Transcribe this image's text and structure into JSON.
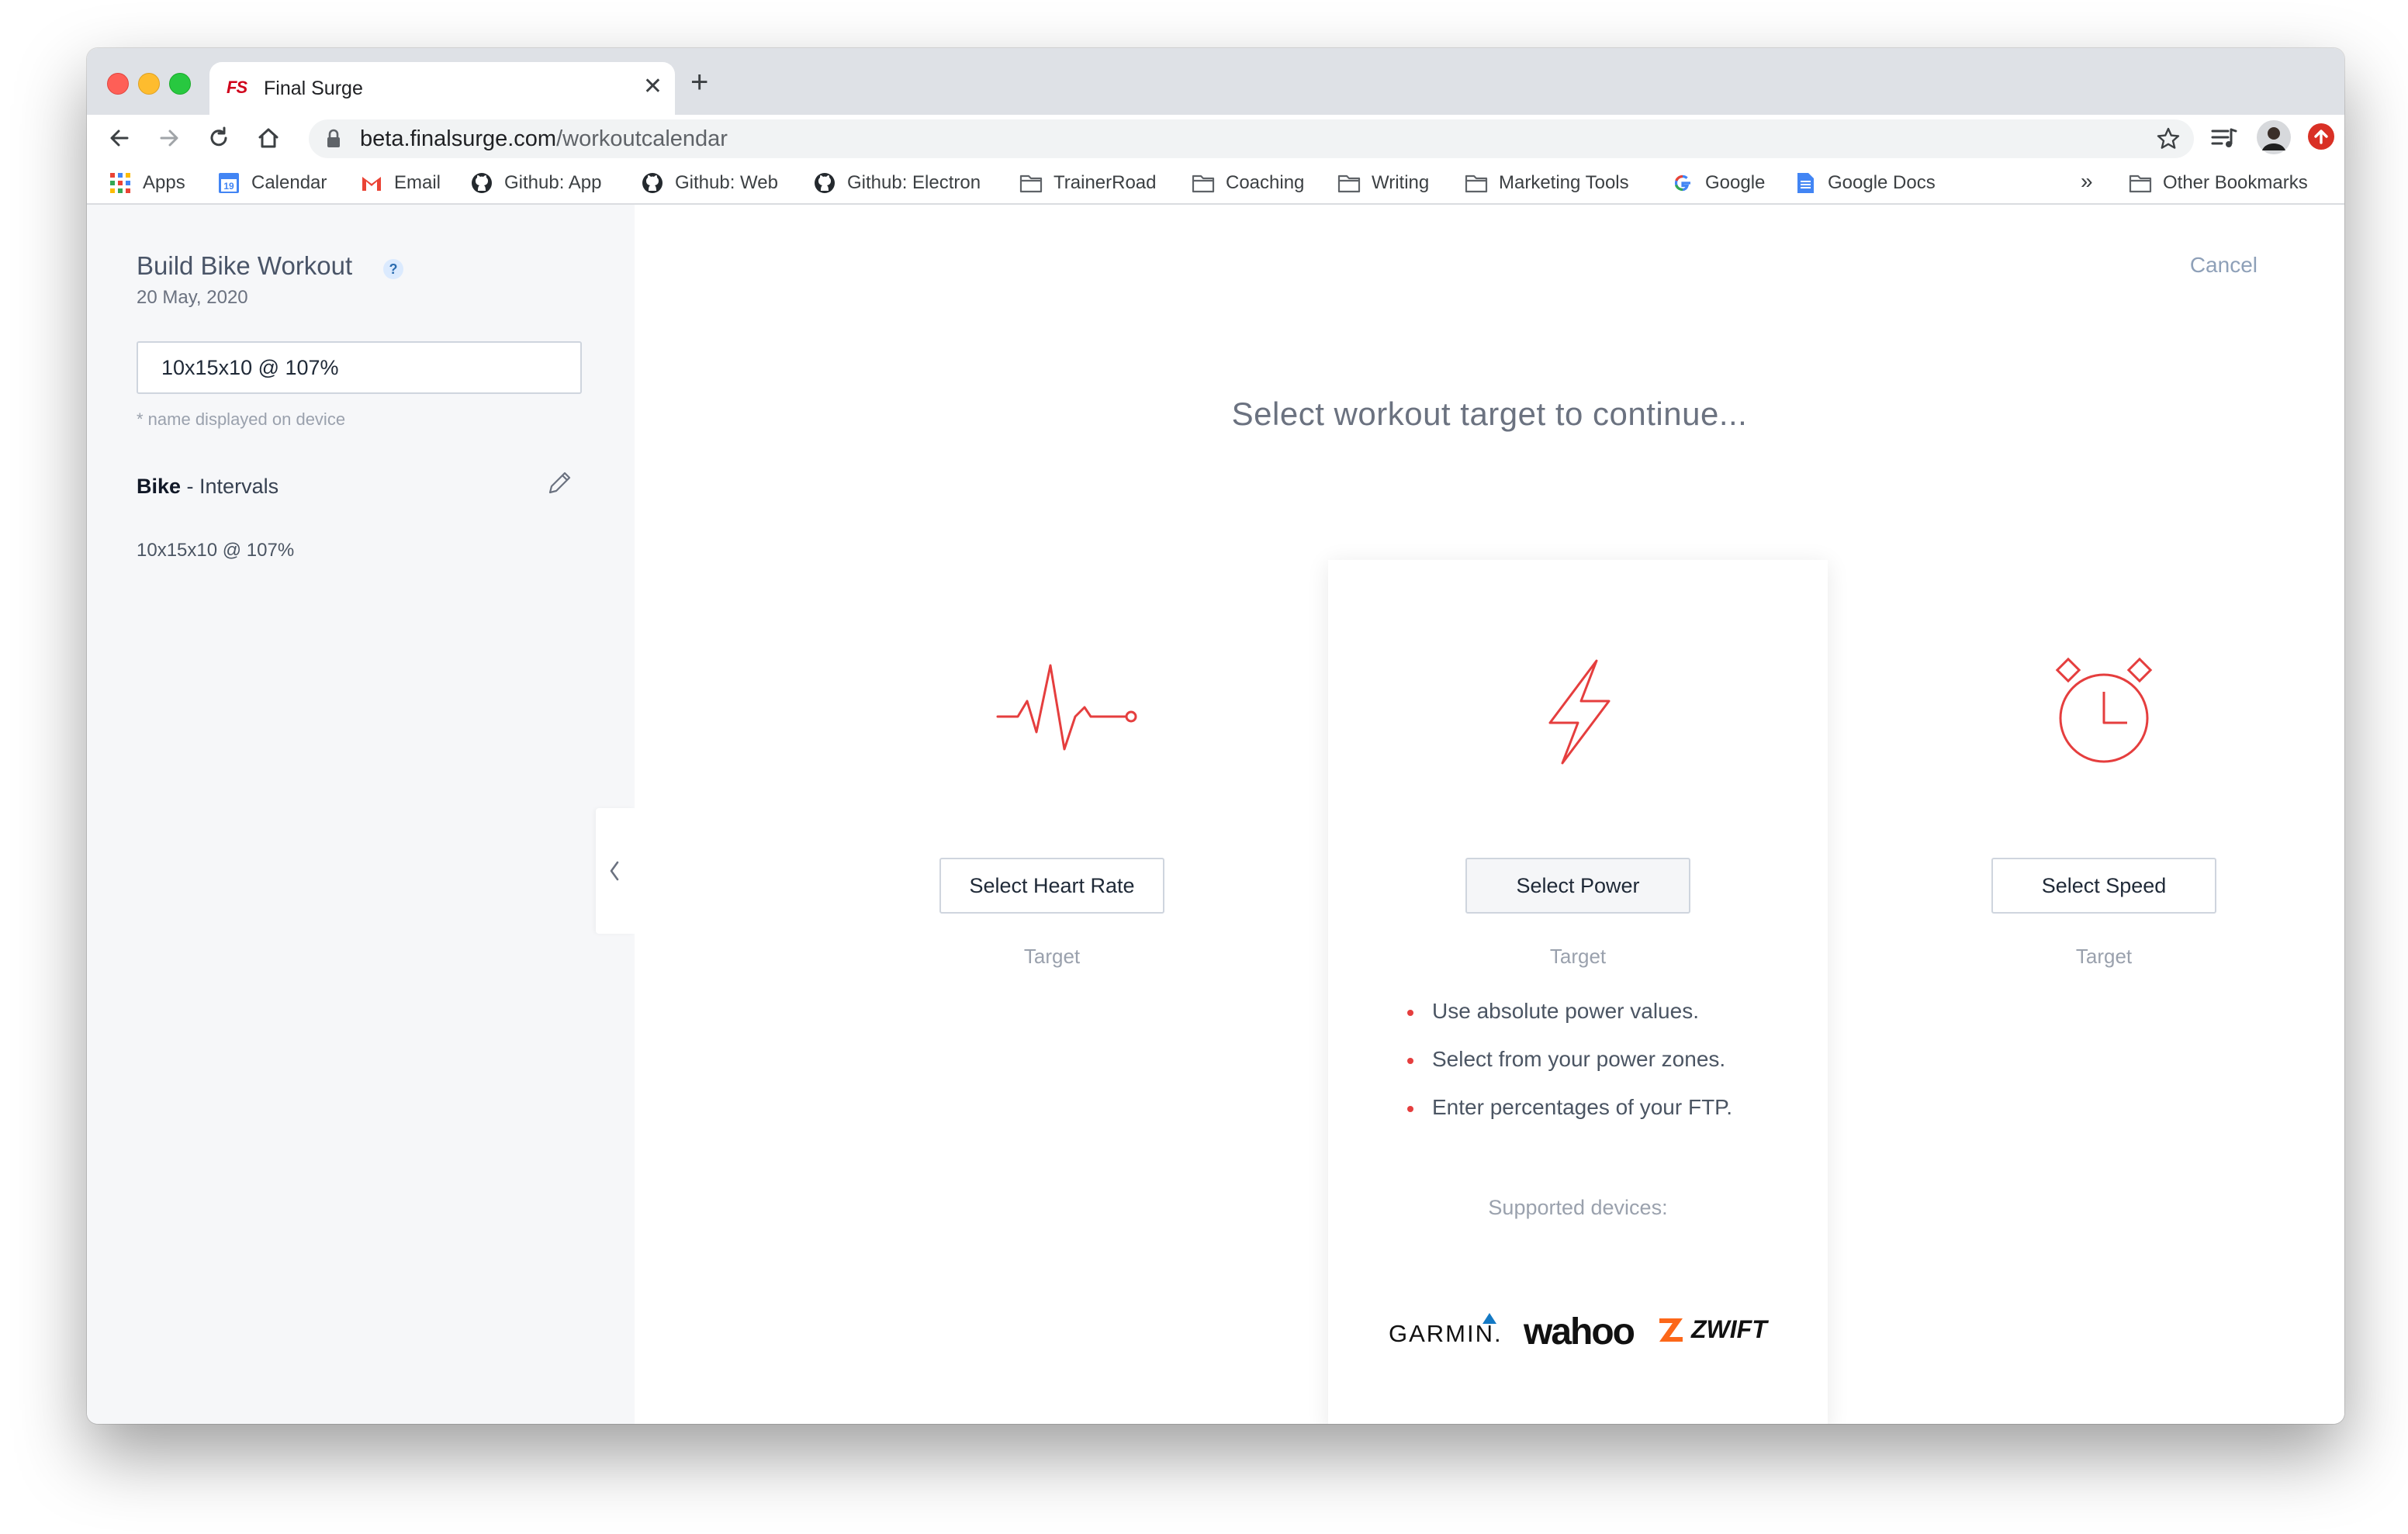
{
  "browser": {
    "tab_title": "Final Surge",
    "tab_favicon": "FS",
    "url_host": "beta.finalsurge.com",
    "url_path": "/workoutcalendar",
    "bookmarks": [
      {
        "label": "Apps",
        "icon": "apps-grid-icon"
      },
      {
        "label": "Calendar",
        "icon": "calendar-icon"
      },
      {
        "label": "Email",
        "icon": "gmail-icon"
      },
      {
        "label": "Github: App",
        "icon": "github-icon"
      },
      {
        "label": "Github: Web",
        "icon": "github-icon"
      },
      {
        "label": "Github: Electron",
        "icon": "github-icon"
      },
      {
        "label": "TrainerRoad",
        "icon": "folder-icon"
      },
      {
        "label": "Coaching",
        "icon": "folder-icon"
      },
      {
        "label": "Writing",
        "icon": "folder-icon"
      },
      {
        "label": "Marketing Tools",
        "icon": "folder-icon"
      },
      {
        "label": "Google",
        "icon": "google-icon"
      },
      {
        "label": "Google Docs",
        "icon": "docs-icon"
      }
    ],
    "overflow": "»",
    "other_bookmarks": "Other Bookmarks",
    "calendar_day": "19"
  },
  "sidebar": {
    "title": "Build Bike Workout",
    "help": "?",
    "date": "20 May, 2020",
    "name_value": "10x15x10 @ 107%",
    "name_hint": "* name displayed on device",
    "sport_bold": "Bike",
    "sport_rest": " - Intervals",
    "structure": "10x15x10 @ 107%"
  },
  "main": {
    "cancel": "Cancel",
    "heading": "Select workout target to continue...",
    "cards": [
      {
        "button": "Select Heart Rate",
        "sub": "Target",
        "icon": "heart-rate-icon"
      },
      {
        "button": "Select Power",
        "sub": "Target",
        "icon": "lightning-bolt-icon",
        "bullets": [
          "Use absolute power values.",
          "Select from your power zones.",
          "Enter percentages of your FTP."
        ],
        "devices_label": "Supported devices:",
        "devices": [
          "GARMIN.",
          "wahoo",
          "ZWIFT"
        ]
      },
      {
        "button": "Select Speed",
        "sub": "Target",
        "icon": "stopwatch-icon"
      }
    ]
  },
  "colors": {
    "accent_red": "#e53e3e",
    "heading_gray": "#6b7280",
    "cancel_blue_gray": "#8ea0b8",
    "sidebar_bg": "#f6f7f9"
  }
}
